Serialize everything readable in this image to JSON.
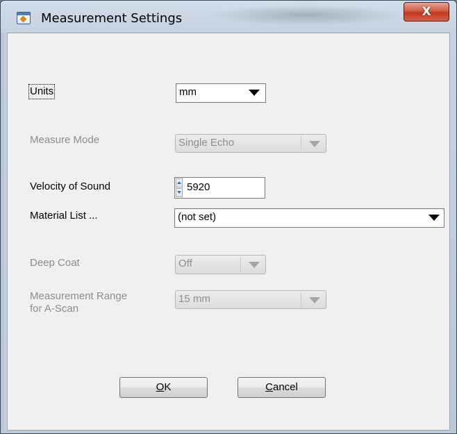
{
  "window": {
    "title": "Measurement Settings",
    "close_glyph": "X",
    "icon": "app-window-icon"
  },
  "form": {
    "units": {
      "label": "Units",
      "value": "mm",
      "enabled": true
    },
    "measure_mode": {
      "label": "Measure Mode",
      "value": "Single Echo",
      "enabled": false
    },
    "velocity": {
      "label": "Velocity of Sound",
      "value": "5920",
      "enabled": true
    },
    "material_list": {
      "label": "Material List ...",
      "value": "(not set)",
      "enabled": true
    },
    "deep_coat": {
      "label": "Deep Coat",
      "value": "Off",
      "enabled": false
    },
    "measurement_range": {
      "label_line1": "Measurement Range",
      "label_line2": "for A-Scan",
      "value": "15 mm",
      "enabled": false
    }
  },
  "buttons": {
    "ok": {
      "accel": "O",
      "rest": "K"
    },
    "cancel": {
      "accel": "C",
      "rest": "ancel"
    }
  }
}
